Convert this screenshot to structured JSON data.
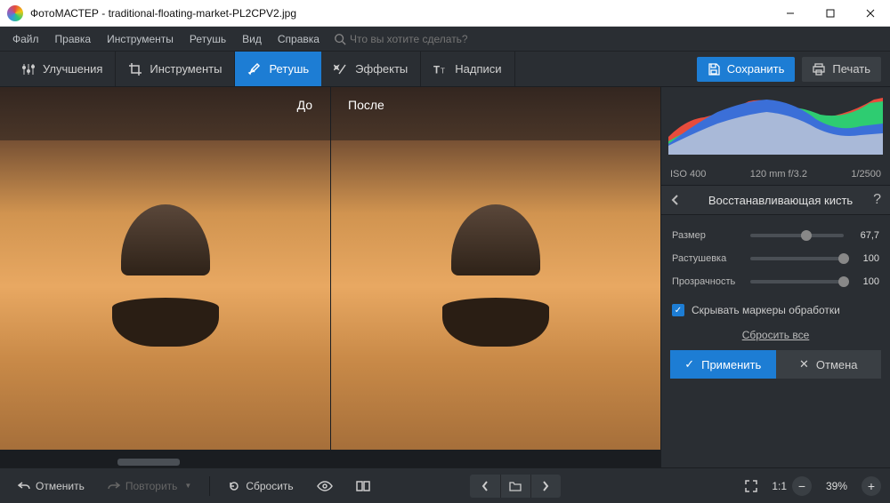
{
  "titlebar": {
    "title": "ФотоМАСТЕР - traditional-floating-market-PL2CPV2.jpg"
  },
  "menubar": {
    "items": [
      "Файл",
      "Правка",
      "Инструменты",
      "Ретушь",
      "Вид",
      "Справка"
    ],
    "search_placeholder": "Что вы хотите сделать?"
  },
  "toolbar": {
    "tabs": [
      {
        "label": "Улучшения"
      },
      {
        "label": "Инструменты"
      },
      {
        "label": "Ретушь"
      },
      {
        "label": "Эффекты"
      },
      {
        "label": "Надписи"
      }
    ],
    "active_index": 2,
    "save_label": "Сохранить",
    "print_label": "Печать"
  },
  "compare": {
    "before": "До",
    "after": "После"
  },
  "histogram": {
    "iso": "ISO 400",
    "focal": "120 mm f/3.2",
    "shutter": "1/2500"
  },
  "panel": {
    "title": "Восстанавливающая кисть",
    "sliders": [
      {
        "label": "Размер",
        "value": "67,7",
        "pos": 60
      },
      {
        "label": "Растушевка",
        "value": "100",
        "pos": 100
      },
      {
        "label": "Прозрачность",
        "value": "100",
        "pos": 100
      }
    ],
    "checkbox": "Скрывать маркеры обработки",
    "reset": "Сбросить все",
    "apply": "Применить",
    "cancel": "Отмена"
  },
  "bottombar": {
    "undo": "Отменить",
    "redo": "Повторить",
    "reset": "Сбросить",
    "ratio": "1:1",
    "zoom": "39%"
  }
}
